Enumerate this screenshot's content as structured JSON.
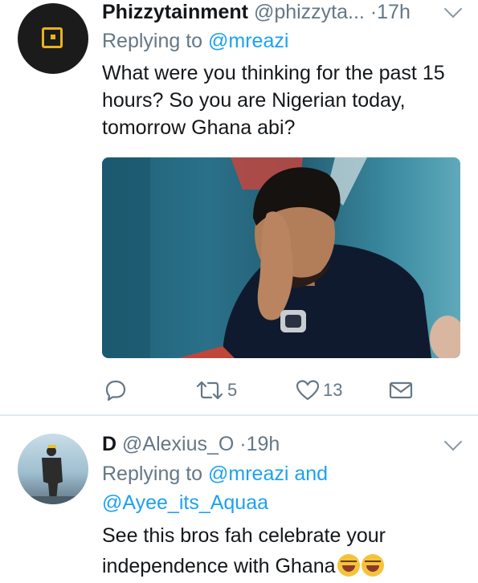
{
  "tweets": [
    {
      "display_name": "Phizzytainment",
      "handle": "@phizzyta...",
      "separator": "·",
      "time": "17h",
      "replying_prefix": "Replying to",
      "replying_mentions": [
        "@mreazi"
      ],
      "text": "What were you thinking for the past 15 hours? So you are Nigerian today, tomorrow Ghana abi?",
      "actions": {
        "retweets": "5",
        "likes": "13"
      },
      "avatar_icon": "yellow-square-logo-icon"
    },
    {
      "display_name": "D",
      "handle": "@Alexius_O",
      "separator": "·",
      "time": "19h",
      "replying_prefix": "Replying to",
      "replying_mentions": [
        "@mreazi",
        "@Ayee_its_Aquaa"
      ],
      "replying_joiner": "and",
      "text_lines": [
        "See this bros fah celebrate your",
        "independence with Ghana"
      ],
      "trailing_emoji": [
        "face-with-tears-of-joy",
        "face-with-tears-of-joy"
      ]
    }
  ],
  "colors": {
    "link": "#1da1f2",
    "secondary_text": "#657786",
    "primary_text": "#14171a",
    "divider": "#e1e8ed"
  }
}
